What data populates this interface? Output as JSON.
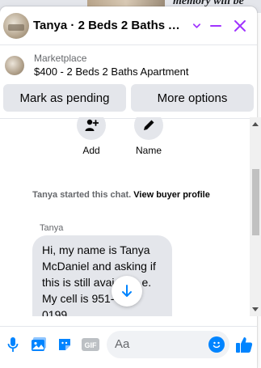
{
  "background": {
    "peek_text": "memory will be"
  },
  "header": {
    "title": "Tanya · 2 Beds 2 Baths Apa..."
  },
  "listing": {
    "source": "Marketplace",
    "title": "$400 - 2 Beds 2 Baths Apartment"
  },
  "actions": {
    "mark_pending": "Mark as pending",
    "more_options": "More options"
  },
  "quick_actions": {
    "add": "Add",
    "name": "Name"
  },
  "chat": {
    "started_text": "Tanya started this chat.",
    "view_profile": "View buyer profile",
    "sender": "Tanya",
    "message_line1": "Hi, my name is Tanya",
    "message_line2": "McDaniel and asking if",
    "message_line3": "this is still avai",
    "message_line3_tail": "e.",
    "message_line4": "My cell is 951-",
    "message_line5": "0199."
  },
  "composer": {
    "placeholder": "Aa"
  },
  "colors": {
    "accent": "#0084ff",
    "header_accent": "#a033ff"
  }
}
